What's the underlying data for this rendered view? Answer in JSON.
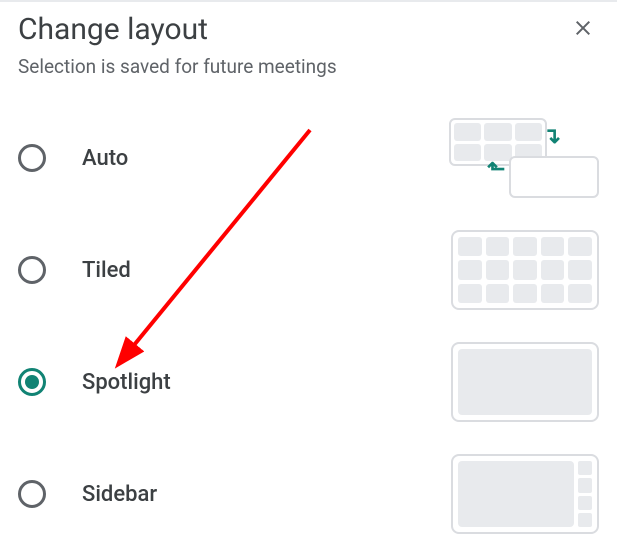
{
  "header": {
    "title": "Change layout",
    "subtitle": "Selection is saved for future meetings"
  },
  "options": [
    {
      "id": "auto",
      "label": "Auto",
      "selected": false
    },
    {
      "id": "tiled",
      "label": "Tiled",
      "selected": false
    },
    {
      "id": "spotlight",
      "label": "Spotlight",
      "selected": true
    },
    {
      "id": "sidebar",
      "label": "Sidebar",
      "selected": false
    }
  ]
}
